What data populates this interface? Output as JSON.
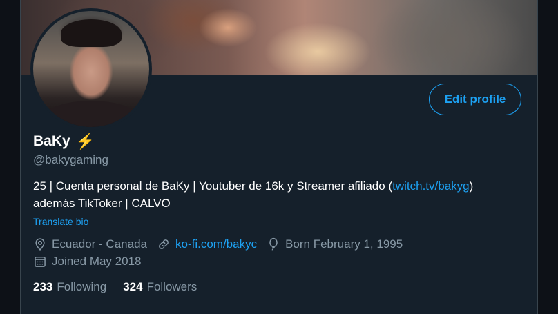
{
  "profile": {
    "name": "BaKy",
    "name_emoji": "⚡",
    "handle": "@bakygaming",
    "bio_text": "25 | Cuenta personal de BaKy | Youtuber de 16k y Streamer afiliado (",
    "bio_link": "twitch.tv/bakyg",
    "bio_close": ")",
    "bio_line2": "además TikToker | CALVO",
    "translate_label": "Translate bio",
    "location": "Ecuador - Canada",
    "website": "ko-fi.com/bakyc",
    "birthday": "Born February 1, 1995",
    "joined": "Joined May 2018",
    "following_count": "233",
    "following_label": "Following",
    "followers_count": "324",
    "followers_label": "Followers"
  },
  "actions": {
    "edit_profile_label": "Edit profile"
  },
  "icons": {
    "location": "location-pin-icon",
    "website": "link-icon",
    "birthday": "balloon-icon",
    "joined": "calendar-icon"
  },
  "colors": {
    "background": "#15202b",
    "accent": "#1da1f2",
    "secondary_text": "#8899a6",
    "primary_text": "#ffffff"
  }
}
